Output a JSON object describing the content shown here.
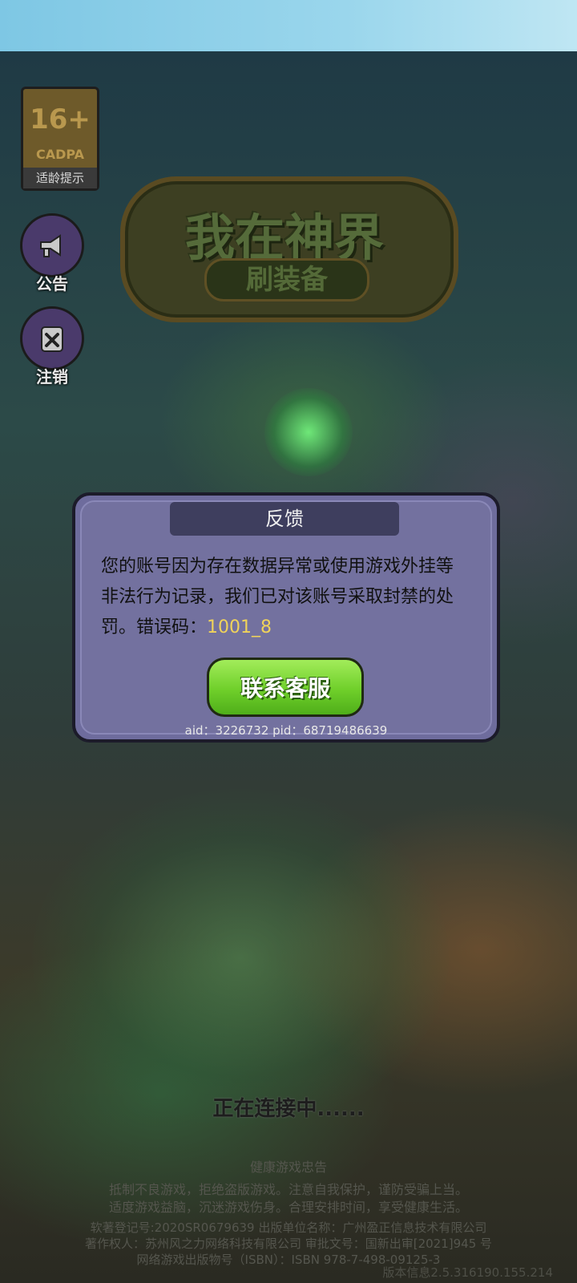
{
  "age_badge": {
    "age": "16+",
    "org": "CADPA",
    "tip": "适龄提示"
  },
  "side_buttons": {
    "announcement": "公告",
    "logout": "注销"
  },
  "logo": {
    "title": "我在神界",
    "subtitle": "刷装备"
  },
  "dialog": {
    "title": "反馈",
    "message": "您的账号因为存在数据异常或使用游戏外挂等非法行为记录，我们已对该账号采取封禁的处罚。错误码：",
    "error_code": "1001_8",
    "contact_button": "联系客服",
    "ids": "aid：3226732  pid：68719486639"
  },
  "status": {
    "connecting": "正在连接中......"
  },
  "footer": {
    "title": "健康游戏忠告",
    "advice_line1": "抵制不良游戏，拒绝盗版游戏。注意自我保护，谨防受骗上当。",
    "advice_line2": "适度游戏益脑，沉迷游戏伤身。合理安排时间，享受健康生活。",
    "line3": "软著登记号:2020SR0679639 出版单位名称：广州盈正信息技术有限公司",
    "line4": "著作权人：苏州风之力网络科技有限公司 审批文号：国新出审[2021]945 号",
    "line5": "网络游戏出版物号（ISBN）：ISBN 978-7-498-09125-3",
    "version": "版本信息2.5.316190.155.214"
  },
  "colors": {
    "dialog_bg": "#6e6c9d",
    "contact_button": "#6fcf2a",
    "error_code": "#f0d35a"
  }
}
